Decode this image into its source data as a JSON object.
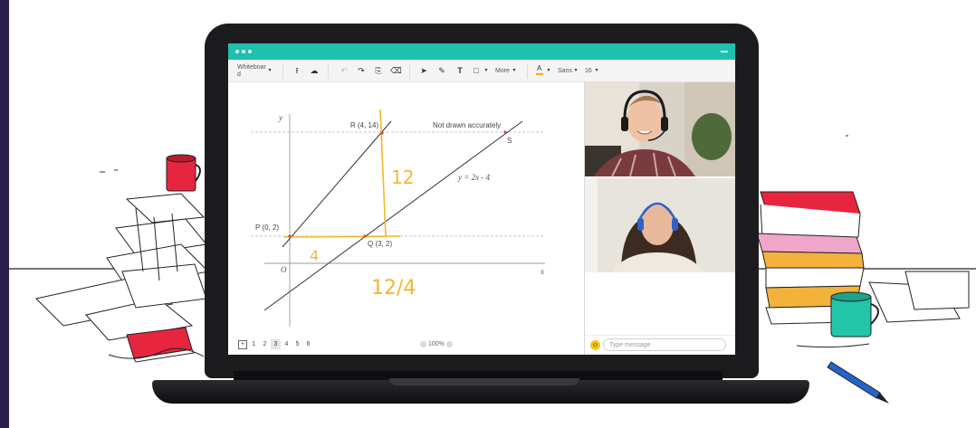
{
  "window": {
    "toolbar": {
      "whiteboard_label": "Whiteboar\nd",
      "more_label": "More",
      "font_name": "Sans",
      "font_size": "16",
      "text_tool": "T",
      "font_color_letter": "A"
    }
  },
  "board": {
    "labels": {
      "y_axis": "y",
      "x_axis": "x",
      "origin": "O",
      "point_r": "R (4, 14)",
      "point_p": "P (0, 2)",
      "point_q": "Q (3, 2)",
      "point_s": "S",
      "note": "Not drawn accurately",
      "equation": "y = 2x - 4"
    },
    "handwriting": {
      "rise": "12",
      "run": "4",
      "slope": "12/4"
    },
    "accent_color": "#f2b62b",
    "point_color": "#e0453a"
  },
  "pages": {
    "add_symbol": "+",
    "items": [
      "1",
      "2",
      "3",
      "4",
      "5",
      "6"
    ],
    "active": "3",
    "zoom": "100%"
  },
  "chat": {
    "placeholder": "Type message",
    "emoji": "☺"
  },
  "video": {
    "participant_1": "tutor-video",
    "participant_2": "student-video"
  },
  "colors": {
    "titlebar": "#1fc0ae",
    "laptop": "#1c1c1e",
    "page_band": "#2a1f4c"
  }
}
